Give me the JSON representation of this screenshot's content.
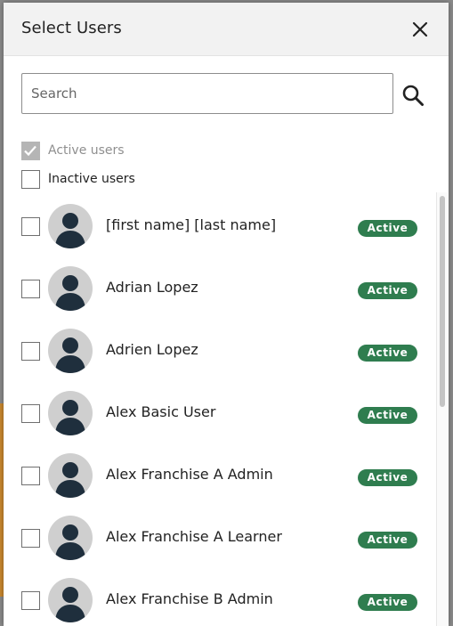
{
  "modal": {
    "title": "Select Users",
    "close_icon": "close-icon"
  },
  "search": {
    "placeholder": "Search",
    "value": "",
    "icon": "search-icon"
  },
  "filters": [
    {
      "label": "Active users",
      "checked": true,
      "disabled": true
    },
    {
      "label": "Inactive users",
      "checked": false,
      "disabled": false
    }
  ],
  "users": [
    {
      "name": "[first name] [last name]",
      "status": "Active",
      "checked": false
    },
    {
      "name": "Adrian Lopez",
      "status": "Active",
      "checked": false
    },
    {
      "name": "Adrien Lopez",
      "status": "Active",
      "checked": false
    },
    {
      "name": "Alex Basic User",
      "status": "Active",
      "checked": false
    },
    {
      "name": "Alex Franchise A Admin",
      "status": "Active",
      "checked": false
    },
    {
      "name": "Alex Franchise A Learner",
      "status": "Active",
      "checked": false
    },
    {
      "name": "Alex Franchise B Admin",
      "status": "Active",
      "checked": false
    }
  ],
  "colors": {
    "header_bg": "#f2f2f2",
    "badge_active": "#2f7d4f",
    "avatar_bg": "#cfcfcf",
    "avatar_fg": "#1f2f3d"
  }
}
